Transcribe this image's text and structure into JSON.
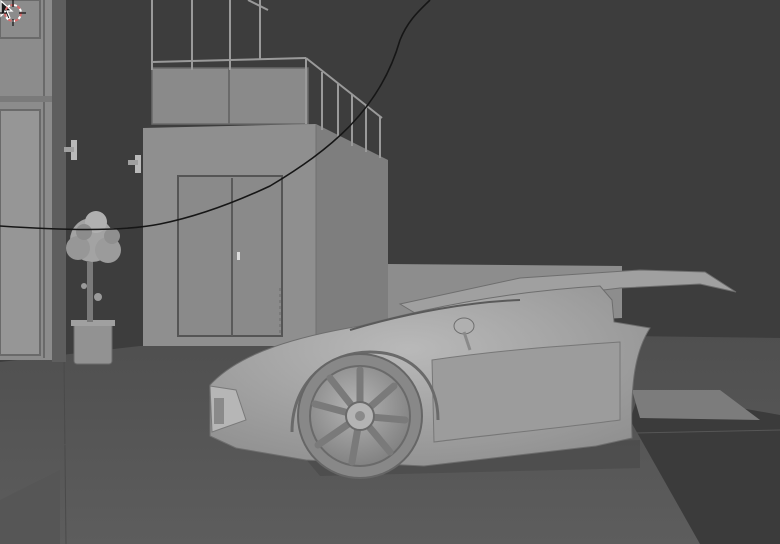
{
  "viewport": {
    "mode": "3d-viewport-solid-shading",
    "colors": {
      "background": "#3d3d3d",
      "ground": "#5c5c5c",
      "wall_light": "#8e8e8e",
      "wall_mid": "#7d7d7d",
      "car_body": "#a8a8a8",
      "car_shadow": "#6f6f6f",
      "edge": "#2e2e2e",
      "curve": "#161616",
      "cursor_ring": "#d96a6a"
    }
  },
  "objects": [
    {
      "id": "left-building",
      "icon": "mesh-building"
    },
    {
      "id": "shed-with-double-door",
      "icon": "mesh-shed"
    },
    {
      "id": "rooftop-railing",
      "icon": "mesh-railing"
    },
    {
      "id": "potted-tree",
      "icon": "mesh-plant"
    },
    {
      "id": "wall-lamps",
      "icon": "mesh-lamp"
    },
    {
      "id": "sports-car",
      "icon": "mesh-car"
    },
    {
      "id": "bezier-curve",
      "icon": "curve"
    },
    {
      "id": "ground-plane",
      "icon": "mesh-plane"
    }
  ],
  "overlays": {
    "mouse_cursor": "arrow-cursor-icon",
    "scene_cursor": "3d-cursor-icon"
  }
}
